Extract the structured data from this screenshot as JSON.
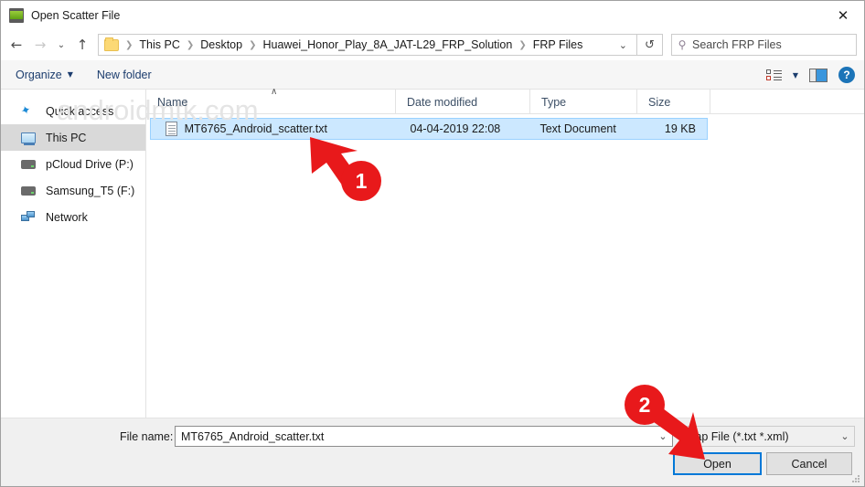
{
  "window": {
    "title": "Open Scatter File",
    "icon": "device-icon",
    "close_label": "✕"
  },
  "nav": {
    "back": "←",
    "forward": "→",
    "history": "⌄",
    "up": "↑",
    "refresh": "↺",
    "dropdown_caret": "⌄"
  },
  "breadcrumb": {
    "items": [
      "This PC",
      "Desktop",
      "Huawei_Honor_Play_8A_JAT-L29_FRP_Solution",
      "FRP Files"
    ],
    "separator": "❯"
  },
  "search": {
    "placeholder": "Search FRP Files",
    "icon": "search-icon"
  },
  "toolbar": {
    "organize_label": "Organize",
    "organize_caret": "▼",
    "new_folder_label": "New folder",
    "view_caret": "▼",
    "help_label": "?"
  },
  "sidebar": {
    "items": [
      {
        "label": "Quick access",
        "icon": "star-icon",
        "selected": false
      },
      {
        "label": "This PC",
        "icon": "computer-icon",
        "selected": true
      },
      {
        "label": "pCloud Drive (P:)",
        "icon": "drive-icon",
        "selected": false
      },
      {
        "label": "Samsung_T5 (F:)",
        "icon": "drive-icon",
        "selected": false
      },
      {
        "label": "Network",
        "icon": "network-icon",
        "selected": false
      }
    ]
  },
  "file_list": {
    "columns": [
      "Name",
      "Date modified",
      "Type",
      "Size"
    ],
    "sort_indicator": "∧",
    "rows": [
      {
        "name": "MT6765_Android_scatter.txt",
        "date_modified": "04-04-2019 22:08",
        "type": "Text Document",
        "size": "19 KB",
        "icon": "text-file-icon",
        "selected": true
      }
    ]
  },
  "watermark": {
    "text": "androidmtk.com"
  },
  "footer": {
    "filename_label": "File name:",
    "filename_value": "MT6765_Android_scatter.txt",
    "filename_caret": "⌄",
    "filter_value": "Map File (*.txt *.xml)",
    "filter_caret": "⌄",
    "open_label": "Open",
    "cancel_label": "Cancel"
  },
  "annotations": [
    {
      "number": "1",
      "target": "selected-file-row"
    },
    {
      "number": "2",
      "target": "open-button"
    }
  ],
  "colors": {
    "accent": "#0078d7",
    "annotation_red": "#e8191b",
    "selection_blue": "#cce8ff",
    "sidebar_selected": "#d9d9d9",
    "command_link": "#1c3d6e"
  }
}
